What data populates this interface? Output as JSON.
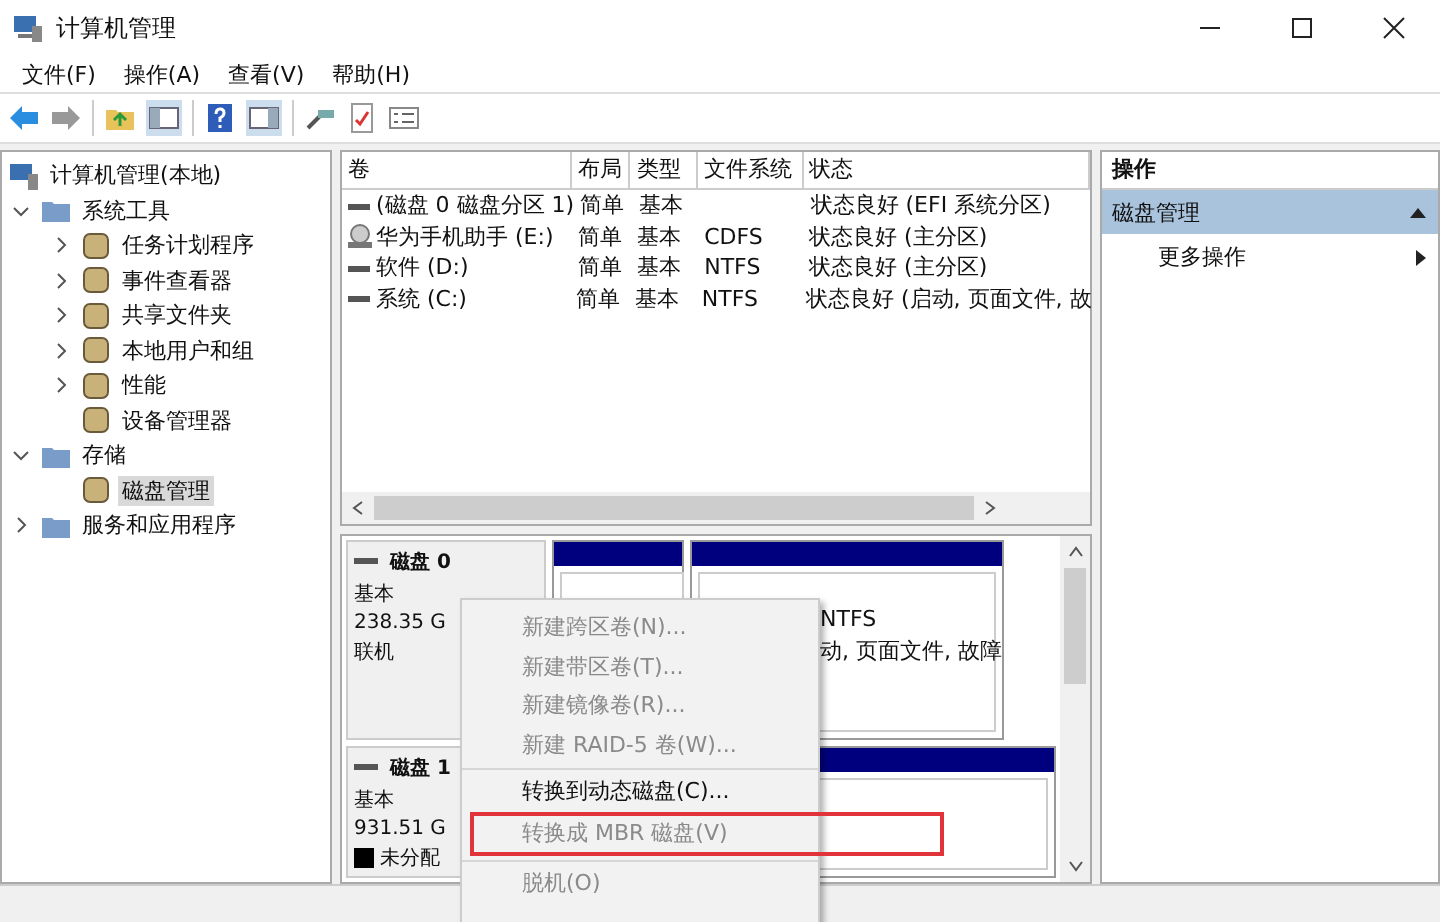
{
  "window": {
    "title": "计算机管理"
  },
  "menu": [
    "文件(F)",
    "操作(A)",
    "查看(V)",
    "帮助(H)"
  ],
  "tree": {
    "root": {
      "label": "计算机管理(本地)"
    },
    "items": [
      {
        "label": "系统工具",
        "expanded": true,
        "selected": false,
        "children": [
          {
            "label": "任务计划程序",
            "expanded": false,
            "selected": false
          },
          {
            "label": "事件查看器",
            "expanded": false,
            "selected": false
          },
          {
            "label": "共享文件夹",
            "expanded": false,
            "selected": false
          },
          {
            "label": "本地用户和组",
            "expanded": false,
            "selected": false
          },
          {
            "label": "性能",
            "expanded": false,
            "selected": false
          },
          {
            "label": "设备管理器",
            "selected": false
          }
        ]
      },
      {
        "label": "存储",
        "expanded": true,
        "selected": false,
        "children": [
          {
            "label": "磁盘管理",
            "selected": true
          }
        ]
      },
      {
        "label": "服务和应用程序",
        "expanded": false,
        "selected": false
      }
    ]
  },
  "volumes": {
    "columns": [
      "卷",
      "布局",
      "类型",
      "文件系统",
      "状态"
    ],
    "rows": [
      {
        "kind": "disk",
        "cells": [
          "(磁盘 0 磁盘分区 1)",
          "简单",
          "基本",
          "",
          "状态良好 (EFI 系统分区)"
        ]
      },
      {
        "kind": "cd",
        "cells": [
          "华为手机助手 (E:)",
          "简单",
          "基本",
          "CDFS",
          "状态良好 (主分区)"
        ]
      },
      {
        "kind": "disk",
        "cells": [
          "软件 (D:)",
          "简单",
          "基本",
          "NTFS",
          "状态良好 (主分区)"
        ]
      },
      {
        "kind": "disk",
        "cells": [
          "系统 (C:)",
          "简单",
          "基本",
          "NTFS",
          "状态良好 (启动, 页面文件, 故"
        ]
      }
    ]
  },
  "disks": [
    {
      "name": "磁盘 0",
      "lines": [
        "基本",
        "238.35 G",
        "联机"
      ],
      "partitions": [
        {
          "kind": "primary"
        },
        {
          "kind": "primary",
          "lines": [
            "NTFS",
            "动, 页面文件, 故障"
          ]
        }
      ]
    },
    {
      "name": "磁盘 1",
      "lines": [
        "基本",
        "931.51 G"
      ],
      "partitions": [
        {
          "kind": "primary"
        }
      ]
    }
  ],
  "legend": [
    {
      "label": "未分配",
      "color": "#000000"
    }
  ],
  "actions": {
    "title": "操作",
    "section": {
      "label": "磁盘管理",
      "expanded": true
    },
    "items": [
      "更多操作"
    ]
  },
  "context_menu": {
    "items": [
      {
        "label": "新建跨区卷(N)...",
        "disabled": true,
        "separator_before": false,
        "highlighted": false
      },
      {
        "label": "新建带区卷(T)...",
        "disabled": true,
        "separator_before": false,
        "highlighted": false
      },
      {
        "label": "新建镜像卷(R)...",
        "disabled": true,
        "separator_before": false,
        "highlighted": false
      },
      {
        "label": "新建 RAID-5 卷(W)...",
        "disabled": true,
        "separator_before": false,
        "highlighted": false
      },
      {
        "label": "转换到动态磁盘(C)...",
        "disabled": false,
        "separator_before": true,
        "highlighted": false
      },
      {
        "label": "转换成 MBR 磁盘(V)",
        "disabled": true,
        "separator_before": false,
        "highlighted": true
      },
      {
        "label": "脱机(O)",
        "disabled": true,
        "separator_before": true,
        "highlighted": false
      }
    ]
  }
}
